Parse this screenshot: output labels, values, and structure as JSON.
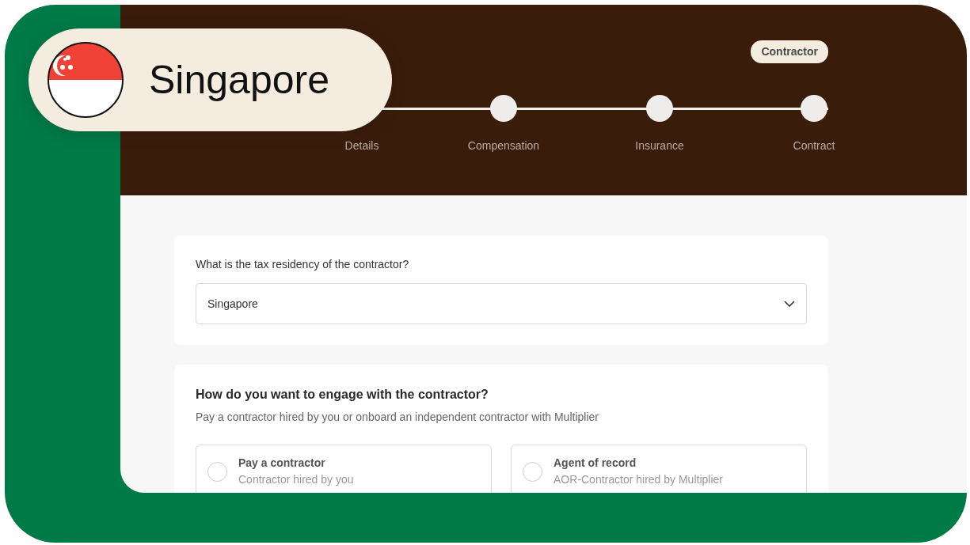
{
  "country_pill": {
    "label": "Singapore"
  },
  "badge": "Contractor",
  "steps": [
    {
      "label": "Details"
    },
    {
      "label": "Compensation"
    },
    {
      "label": "Insurance"
    },
    {
      "label": "Contract"
    }
  ],
  "residency": {
    "question": "What is the tax residency of the contractor?",
    "value": "Singapore"
  },
  "engagement": {
    "title": "How do you want to engage with the contractor?",
    "subtitle": "Pay a contractor hired by you or onboard an independent contractor with Multiplier",
    "options": [
      {
        "title": "Pay a contractor",
        "subtitle": "Contractor hired by you",
        "selected": false
      },
      {
        "title": "Agent of record",
        "subtitle": "AOR-Contractor hired by Multiplier",
        "selected": false
      }
    ]
  }
}
